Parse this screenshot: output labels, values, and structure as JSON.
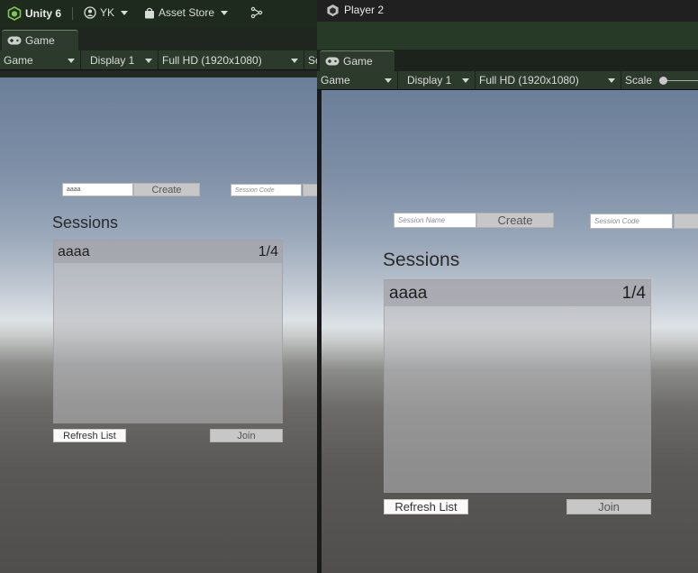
{
  "editor": {
    "topbar": {
      "app_name": "Unity 6",
      "account": "YK",
      "asset_store": "Asset Store"
    },
    "game_tab": "Game",
    "toolbar": {
      "mode": "Game",
      "display": "Display 1",
      "resolution": "Full HD (1920x1080)",
      "scale_cut": "Sc"
    },
    "game_view": {
      "session_name_value": "aaaa",
      "create_label": "Create",
      "session_code_placeholder": "Session Code",
      "sessions_title": "Sessions",
      "sessions": [
        {
          "name": "aaaa",
          "players": "1/4"
        }
      ],
      "refresh_label": "Refresh List",
      "join_label": "Join"
    }
  },
  "player2": {
    "window_title": "Player 2",
    "game_tab": "Game",
    "toolbar": {
      "mode": "Game",
      "display": "Display 1",
      "resolution": "Full HD (1920x1080)",
      "scale_label": "Scale"
    },
    "game_view": {
      "session_name_placeholder": "Session Name",
      "create_label": "Create",
      "session_code_placeholder": "Session Code",
      "sessions_title": "Sessions",
      "sessions": [
        {
          "name": "aaaa",
          "players": "1/4"
        }
      ],
      "refresh_label": "Refresh List",
      "join_label": "Join"
    }
  },
  "colors": {
    "editor_accent": "#2b3a2b",
    "unity_logo": "#7ec850"
  }
}
